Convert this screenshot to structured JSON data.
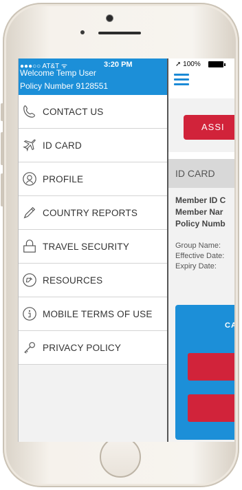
{
  "status": {
    "carrier": "●●●○○ AT&T ᯤ",
    "time": "3:20 PM",
    "battery": "100%"
  },
  "user": {
    "welcome": "Welcome Temp User",
    "policy": "Policy Number 9128551"
  },
  "menu": {
    "items": [
      {
        "label": "CONTACT US",
        "icon": "phone-icon"
      },
      {
        "label": "ID CARD",
        "icon": "airplane-icon"
      },
      {
        "label": "PROFILE",
        "icon": "profile-icon"
      },
      {
        "label": "COUNTRY REPORTS",
        "icon": "pen-icon"
      },
      {
        "label": "TRAVEL SECURITY",
        "icon": "lock-icon"
      },
      {
        "label": "RESOURCES",
        "icon": "resources-icon"
      },
      {
        "label": "MOBILE TERMS OF USE",
        "icon": "info-icon"
      },
      {
        "label": "PRIVACY POLICY",
        "icon": "key-icon"
      }
    ]
  },
  "app": {
    "assist_label": "ASSI",
    "section_title": "ID CARD",
    "member_lines": [
      "Member ID C",
      "Member Nar",
      "Policy Numb"
    ],
    "info_lines": [
      "Group Name:",
      "Effective Date:",
      "Expiry Date:"
    ],
    "card_label": "CA"
  },
  "colors": {
    "accent": "#1c8fd8",
    "danger": "#d1233a"
  }
}
